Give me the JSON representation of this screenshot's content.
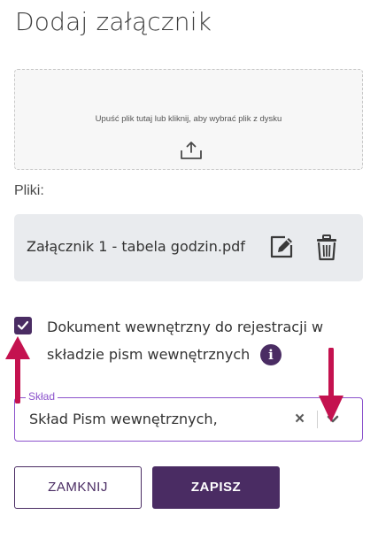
{
  "dialog": {
    "title": "Dodaj załącznik"
  },
  "dropzone": {
    "text": "Upuść plik tutaj lub kliknij, aby wybrać plik z dysku",
    "icon": "upload-icon"
  },
  "files": {
    "label": "Pliki:",
    "items": [
      {
        "name": "Załącznik 1 - tabela godzin.pdf",
        "actions": [
          "edit-icon",
          "trash-icon"
        ]
      }
    ]
  },
  "checkbox": {
    "checked": true,
    "label": "Dokument wewnętrzny do rejestracji w składzie pism wewnętrznych",
    "info_icon": "i"
  },
  "select": {
    "legend": "Skład",
    "value": "Skład Pism wewnętrznych,",
    "clear_symbol": "×"
  },
  "buttons": {
    "close_label": "ZAMKNIJ",
    "save_label": "ZAPISZ"
  },
  "colors": {
    "primary": "#4a2c63",
    "accent": "#8b52cc",
    "annotation_arrow": "#c4124f"
  }
}
